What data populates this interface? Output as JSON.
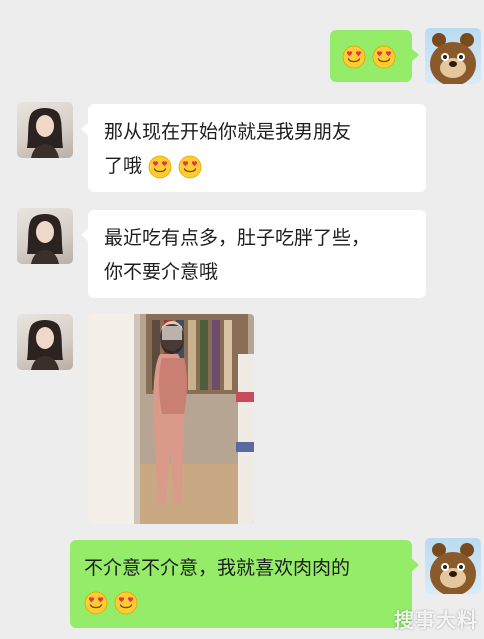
{
  "messages": [
    {
      "side": "right",
      "text": "",
      "emoji_count": 2
    },
    {
      "side": "left",
      "line1": "那从现在开始你就是我男朋友",
      "line2": "了哦",
      "emoji_count": 2
    },
    {
      "side": "left",
      "line1": "最近吃有点多，肚子吃胖了些，",
      "line2": "你不要介意哦"
    },
    {
      "side": "left",
      "type": "image",
      "image_desc": "mirror-selfie-photo"
    },
    {
      "side": "right",
      "line1": "不介意不介意，我就喜欢肉肉的",
      "emoji_count": 2
    }
  ],
  "icons": {
    "emoji": "heart-eyes-emoji-icon",
    "left_avatar": "girl-avatar",
    "right_avatar": "bear-avatar"
  },
  "colors": {
    "background": "#ededed",
    "received_bubble": "#ffffff",
    "sent_bubble": "#95ec69",
    "emoji_face": "#ffcc33"
  },
  "watermark": "搜事大料"
}
